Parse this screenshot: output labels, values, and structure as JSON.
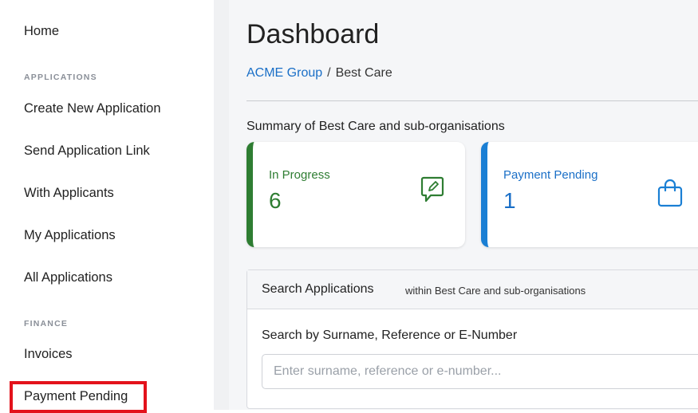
{
  "sidebar": {
    "home": "Home",
    "applications_section": "APPLICATIONS",
    "create_new": "Create New Application",
    "send_link": "Send Application Link",
    "with_applicants": "With Applicants",
    "my_applications": "My Applications",
    "all_applications": "All Applications",
    "finance_section": "FINANCE",
    "invoices": "Invoices",
    "payment_pending": "Payment Pending"
  },
  "main": {
    "title": "Dashboard",
    "breadcrumb": {
      "parent": "ACME Group",
      "separator": "/",
      "current": "Best Care"
    },
    "summary": "Summary of Best Care and sub-organisations",
    "cards": [
      {
        "label": "In Progress",
        "value": "6",
        "icon": "chat-edit-icon",
        "color": "#2e7d32"
      },
      {
        "label": "Payment Pending",
        "value": "1",
        "icon": "shopping-bag-icon",
        "color": "#1a7fd4"
      }
    ],
    "search": {
      "title": "Search Applications",
      "subtitle": "within Best Care and sub-organisations",
      "label": "Search by Surname, Reference or E-Number",
      "placeholder": "Enter surname, reference or e-number...",
      "value": ""
    }
  },
  "colors": {
    "highlight": "#e3121b",
    "link": "#1a6fc7"
  }
}
